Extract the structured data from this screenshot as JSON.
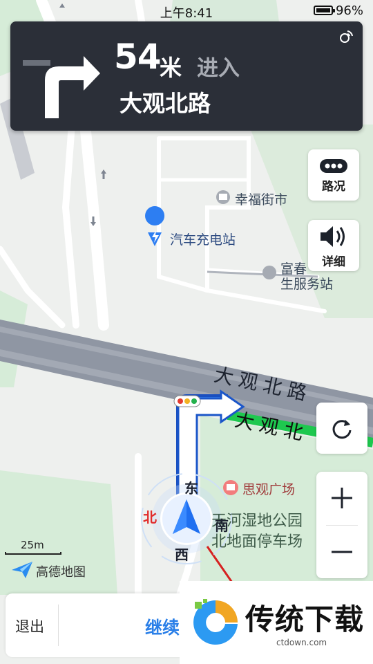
{
  "status": {
    "time": "上午8:41",
    "battery": "96%"
  },
  "guidance": {
    "distance": "54",
    "unit": "米",
    "action": "进入",
    "road": "大观北路"
  },
  "side_buttons": {
    "traffic_label": "路况",
    "detail_label": "详细"
  },
  "map_labels": {
    "poi_market": "幸福街市",
    "poi_charging": "汽车充电站",
    "poi_service_line1": "富春",
    "poi_service_line2": "生服务站",
    "poi_plaza": "思观广场",
    "poi_wetland_line1": "天河湿地公园",
    "poi_wetland_line2": "北地面停车场",
    "road_main": "大观北路",
    "road_route": "大观北"
  },
  "compass": {
    "east": "东",
    "south": "南",
    "west": "西",
    "north": "北"
  },
  "scale": {
    "label": "25m"
  },
  "brand": {
    "name": "高德地图"
  },
  "bottom": {
    "exit_label": "退出",
    "continue_label": "继续"
  },
  "watermark": {
    "title": "传统下载",
    "url": "ctdown.com"
  },
  "colors": {
    "route": "#2f7ef0",
    "traffic_green": "#1ec84f",
    "panel": "#2b2f38",
    "accent": "#2a7fe8"
  }
}
